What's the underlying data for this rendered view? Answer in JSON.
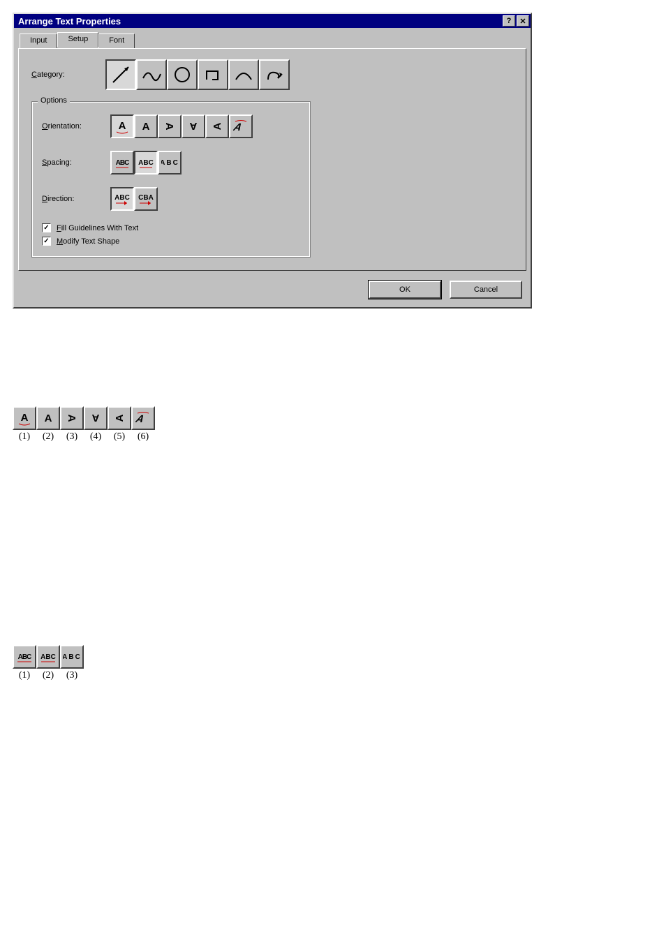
{
  "window": {
    "title": "Arrange Text Properties"
  },
  "tabs": {
    "input": "Input",
    "setup": "Setup",
    "font": "Font",
    "active": "setup"
  },
  "setup_tab": {
    "category_label": "Category:",
    "category_accel": "C",
    "options_title": "Options",
    "orientation_label": "Orientation:",
    "orientation_accel": "O",
    "spacing_label": "Spacing:",
    "spacing_accel": "S",
    "direction_label": "Direction:",
    "direction_accel": "D",
    "direction_btn1": "ABC",
    "direction_btn2": "CBA",
    "fill_label": "Fill Guidelines With Text",
    "fill_accel": "F",
    "fill_checked": true,
    "modify_label": "Modify Text Shape",
    "modify_accel": "M",
    "modify_checked": true
  },
  "buttons": {
    "ok": "OK",
    "cancel": "Cancel"
  },
  "legend_orientation": [
    "(1)",
    "(2)",
    "(3)",
    "(4)",
    "(5)",
    "(6)"
  ],
  "legend_spacing": [
    "(1)",
    "(2)",
    "(3)"
  ]
}
